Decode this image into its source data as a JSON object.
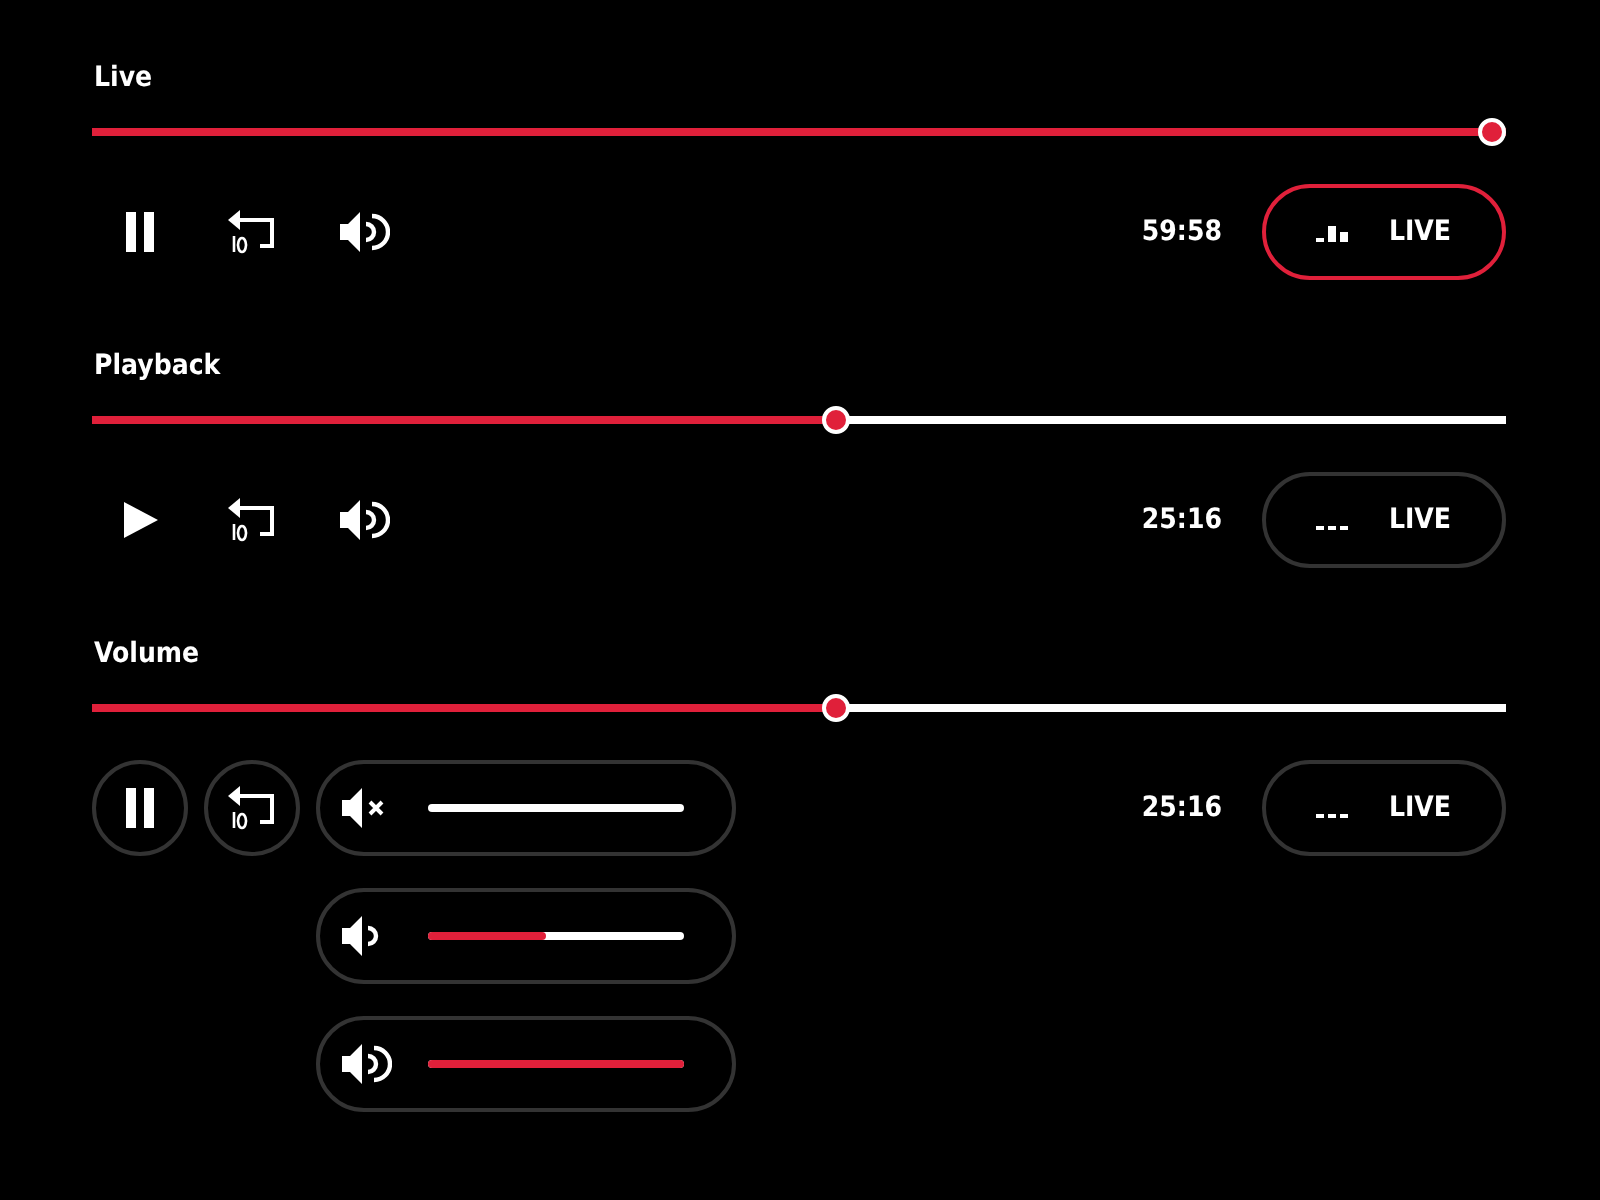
{
  "sections": [
    {
      "title": "Live",
      "level": 1,
      "playing": true,
      "time": "59:58",
      "live": {
        "label": "LIVE",
        "selected": true
      },
      "kind": "plain"
    },
    {
      "title": "Playback",
      "level": 0.527,
      "playing": false,
      "time": "25:16",
      "live": {
        "label": "LIVE",
        "selected": false
      },
      "kind": "plain"
    },
    {
      "title": "Volume",
      "level": 0.527,
      "playing": true,
      "time": "25:16",
      "live": {
        "label": "LIVE",
        "selected": false
      },
      "kind": "circled"
    }
  ],
  "volume_options": [
    {
      "muted": true,
      "level": 0
    },
    {
      "muted": false,
      "level": 0.46
    },
    {
      "muted": false,
      "level": 1
    }
  ]
}
